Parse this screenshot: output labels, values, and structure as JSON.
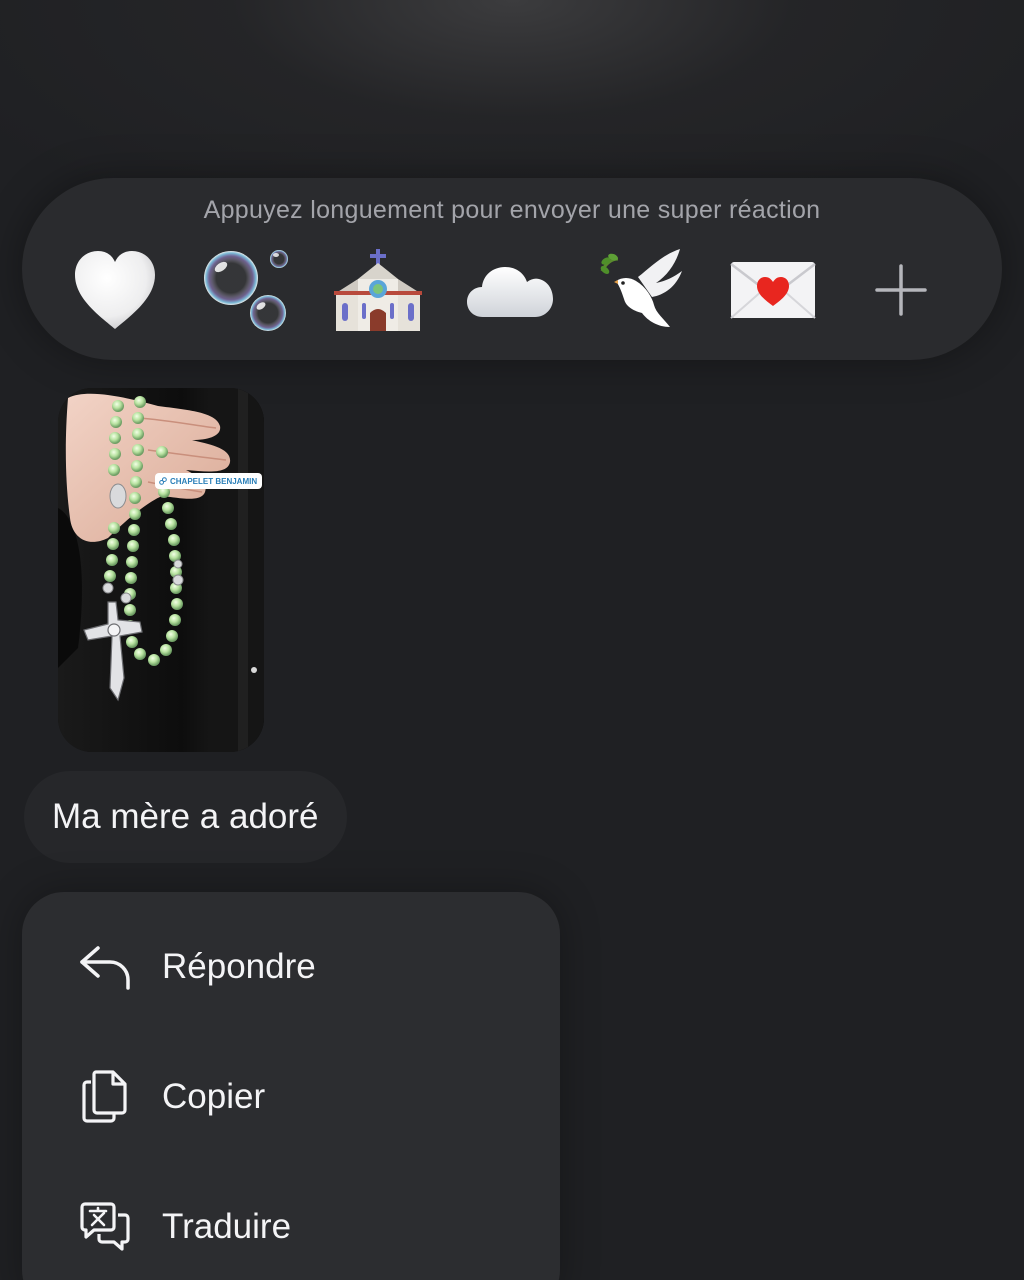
{
  "reaction_bar": {
    "hint": "Appuyez longuement pour envoyer une super réaction",
    "reactions": [
      {
        "name": "white-heart",
        "label": "🤍"
      },
      {
        "name": "bubbles",
        "label": "🫧"
      },
      {
        "name": "church",
        "label": "⛪"
      },
      {
        "name": "cloud",
        "label": "☁️"
      },
      {
        "name": "dove",
        "label": "🕊️"
      },
      {
        "name": "love-letter",
        "label": "💌"
      },
      {
        "name": "more",
        "label": "+"
      }
    ]
  },
  "message": {
    "photo_tag": "CHAPELET BENJAMIN",
    "text": "Ma mère a adoré"
  },
  "menu": {
    "items": [
      {
        "label": "Répondre",
        "icon": "reply-icon"
      },
      {
        "label": "Copier",
        "icon": "copy-icon"
      },
      {
        "label": "Traduire",
        "icon": "translate-icon"
      }
    ]
  },
  "colors": {
    "background": "#1f2023",
    "panel": "#2a2b2e",
    "menu": "#2c2d30",
    "text": "#f4f4f6",
    "hint_text": "#a3a4aa"
  }
}
